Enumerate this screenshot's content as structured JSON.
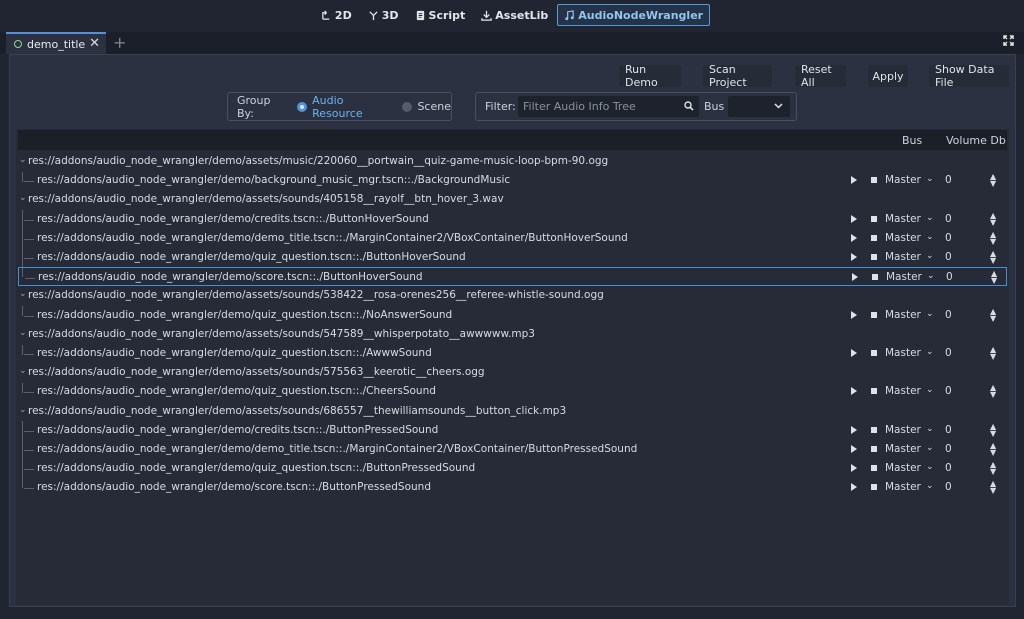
{
  "main_screens": [
    {
      "label": "2D",
      "icon": "2d-icon",
      "active": false
    },
    {
      "label": "3D",
      "icon": "3d-icon",
      "active": false
    },
    {
      "label": "Script",
      "icon": "script-icon",
      "active": false
    },
    {
      "label": "AssetLib",
      "icon": "assetlib-icon",
      "active": false
    },
    {
      "label": "AudioNodeWrangler",
      "icon": "music-icon",
      "active": true
    }
  ],
  "tab": {
    "label": "demo_title"
  },
  "toolbar": {
    "run_demo": "Run Demo",
    "scan_project": "Scan Project",
    "reset_all": "Reset All",
    "apply": "Apply",
    "show_data_file": "Show Data File"
  },
  "group_by": {
    "label": "Group By:",
    "options": [
      "Audio Resource",
      "Scene"
    ],
    "selected": "Audio Resource"
  },
  "filter": {
    "label": "Filter:",
    "placeholder": "Filter Audio Info Tree",
    "bus_label": "Bus"
  },
  "columns": {
    "bus": "Bus",
    "volume": "Volume Db"
  },
  "rows": [
    {
      "kind": "resource",
      "path": "res://addons/audio_node_wrangler/demo/assets/music/220060__portwain__quiz-game-music-loop-bpm-90.ogg"
    },
    {
      "kind": "node",
      "path": "res://addons/audio_node_wrangler/demo/background_music_mgr.tscn::./BackgroundMusic",
      "bus": "Master",
      "volume": "0"
    },
    {
      "kind": "resource",
      "path": "res://addons/audio_node_wrangler/demo/assets/sounds/405158__rayolf__btn_hover_3.wav"
    },
    {
      "kind": "node",
      "path": "res://addons/audio_node_wrangler/demo/credits.tscn::./ButtonHoverSound",
      "bus": "Master",
      "volume": "0"
    },
    {
      "kind": "node",
      "path": "res://addons/audio_node_wrangler/demo/demo_title.tscn::./MarginContainer2/VBoxContainer/ButtonHoverSound",
      "bus": "Master",
      "volume": "0"
    },
    {
      "kind": "node",
      "path": "res://addons/audio_node_wrangler/demo/quiz_question.tscn::./ButtonHoverSound",
      "bus": "Master",
      "volume": "0"
    },
    {
      "kind": "node",
      "path": "res://addons/audio_node_wrangler/demo/score.tscn::./ButtonHoverSound",
      "bus": "Master",
      "volume": "0",
      "selected": true
    },
    {
      "kind": "resource",
      "path": "res://addons/audio_node_wrangler/demo/assets/sounds/538422__rosa-orenes256__referee-whistle-sound.ogg"
    },
    {
      "kind": "node",
      "path": "res://addons/audio_node_wrangler/demo/quiz_question.tscn::./NoAnswerSound",
      "bus": "Master",
      "volume": "0"
    },
    {
      "kind": "resource",
      "path": "res://addons/audio_node_wrangler/demo/assets/sounds/547589__whisperpotato__awwwww.mp3"
    },
    {
      "kind": "node",
      "path": "res://addons/audio_node_wrangler/demo/quiz_question.tscn::./AwwwSound",
      "bus": "Master",
      "volume": "0"
    },
    {
      "kind": "resource",
      "path": "res://addons/audio_node_wrangler/demo/assets/sounds/575563__keerotic__cheers.ogg"
    },
    {
      "kind": "node",
      "path": "res://addons/audio_node_wrangler/demo/quiz_question.tscn::./CheersSound",
      "bus": "Master",
      "volume": "0"
    },
    {
      "kind": "resource",
      "path": "res://addons/audio_node_wrangler/demo/assets/sounds/686557__thewilliamsounds__button_click.mp3"
    },
    {
      "kind": "node",
      "path": "res://addons/audio_node_wrangler/demo/credits.tscn::./ButtonPressedSound",
      "bus": "Master",
      "volume": "0"
    },
    {
      "kind": "node",
      "path": "res://addons/audio_node_wrangler/demo/demo_title.tscn::./MarginContainer2/VBoxContainer/ButtonPressedSound",
      "bus": "Master",
      "volume": "0"
    },
    {
      "kind": "node",
      "path": "res://addons/audio_node_wrangler/demo/quiz_question.tscn::./ButtonPressedSound",
      "bus": "Master",
      "volume": "0"
    },
    {
      "kind": "node",
      "path": "res://addons/audio_node_wrangler/demo/score.tscn::./ButtonPressedSound",
      "bus": "Master",
      "volume": "0"
    }
  ]
}
